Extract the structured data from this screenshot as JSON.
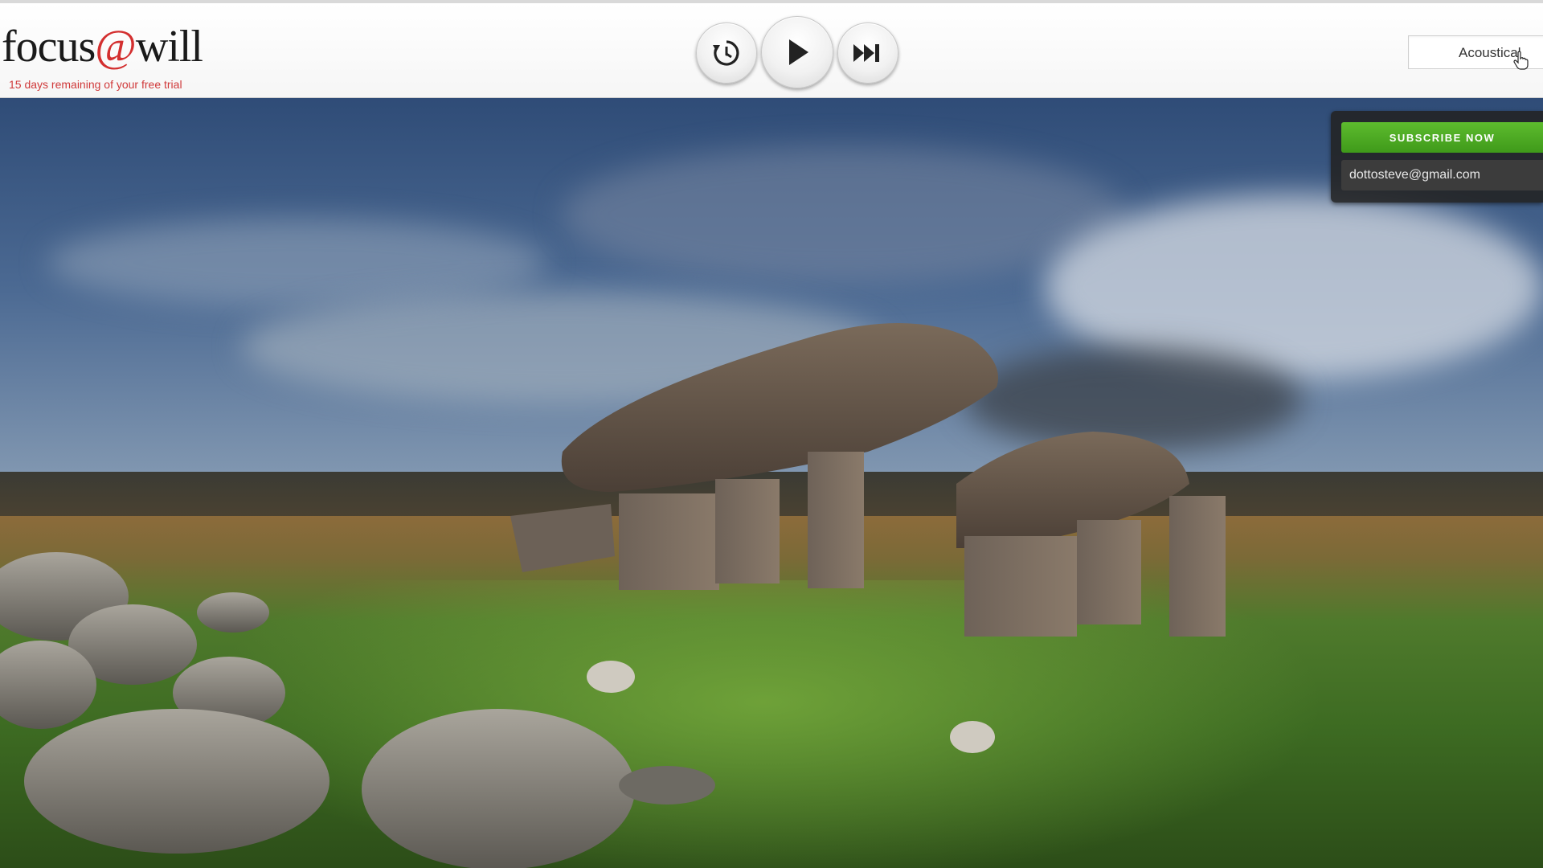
{
  "header": {
    "logo_text_left": "focus",
    "logo_text_at": "@",
    "logo_text_right": "will",
    "trial_notice": "15 days remaining of your free trial",
    "channel_label": "Acoustical"
  },
  "player": {
    "replay_icon": "replay-clock-icon",
    "play_icon": "play-icon",
    "skip_icon": "skip-forward-icon"
  },
  "account": {
    "subscribe_label": "SUBSCRIBE NOW",
    "email": "dottosteve@gmail.com"
  },
  "colors": {
    "brand_red": "#d32f2f",
    "subscribe_green": "#4aa922",
    "panel_bg": "#222222"
  }
}
